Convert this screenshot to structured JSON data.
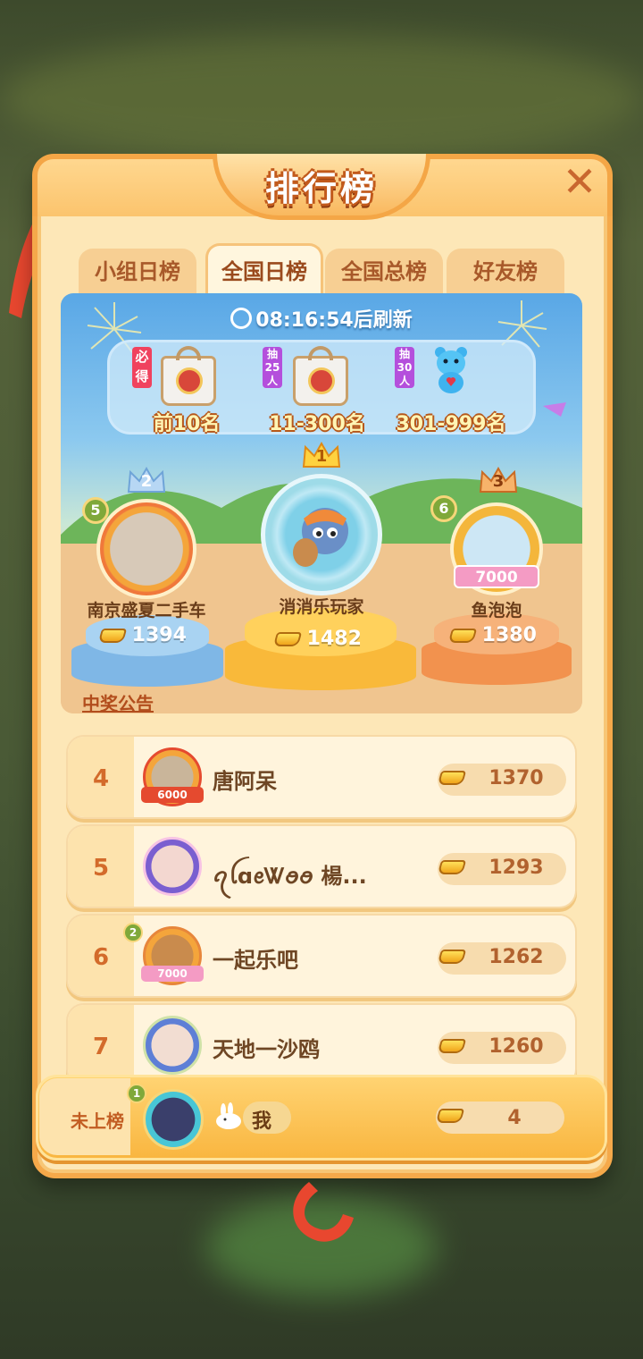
{
  "title": "排行榜",
  "close_icon": "close-icon",
  "tabs": [
    {
      "label": "小组日榜",
      "active": false
    },
    {
      "label": "全国日榜",
      "active": true
    },
    {
      "label": "全国总榜",
      "active": false
    },
    {
      "label": "好友榜",
      "active": false
    }
  ],
  "refresh_text": "08:16:54后刷新",
  "prizes": [
    {
      "tag": "必得",
      "label": "前10名",
      "icon": "gift-bag-icon"
    },
    {
      "tag": "抽25人",
      "label": "11-300名",
      "icon": "gift-bag-icon"
    },
    {
      "tag": "抽30人",
      "label": "301-999名",
      "icon": "blue-bear-plush-icon"
    }
  ],
  "podium": {
    "second": {
      "rank_badge": "2",
      "level": "5",
      "name": "南京盛夏二手车",
      "score": "1394"
    },
    "first": {
      "rank_badge": "1",
      "name": "消消乐玩家",
      "score": "1482"
    },
    "third": {
      "rank_badge": "3",
      "level": "6",
      "name": "鱼泡泡",
      "score": "1380",
      "frame_badge": "7000"
    }
  },
  "notice_link": "中奖公告",
  "list": [
    {
      "rank": "4",
      "name": "唐阿呆",
      "score": "1370",
      "frame_badge": "6000"
    },
    {
      "rank": "5",
      "name": "ꪖꪶɑꫀᏔꪮꪮ 楊...",
      "score": "1293"
    },
    {
      "rank": "6",
      "name": "一起乐吧",
      "score": "1262",
      "frame_badge": "7000",
      "level": "2"
    },
    {
      "rank": "7",
      "name": "天地一沙鸥",
      "score": "1260"
    }
  ],
  "me": {
    "rank_label": "未上榜",
    "level": "1",
    "name": "我",
    "score": "4"
  },
  "colors": {
    "panel": "#fde7b7",
    "accent": "#f5a94a",
    "sky": "#59a7e6",
    "gold": "#f9b640"
  }
}
